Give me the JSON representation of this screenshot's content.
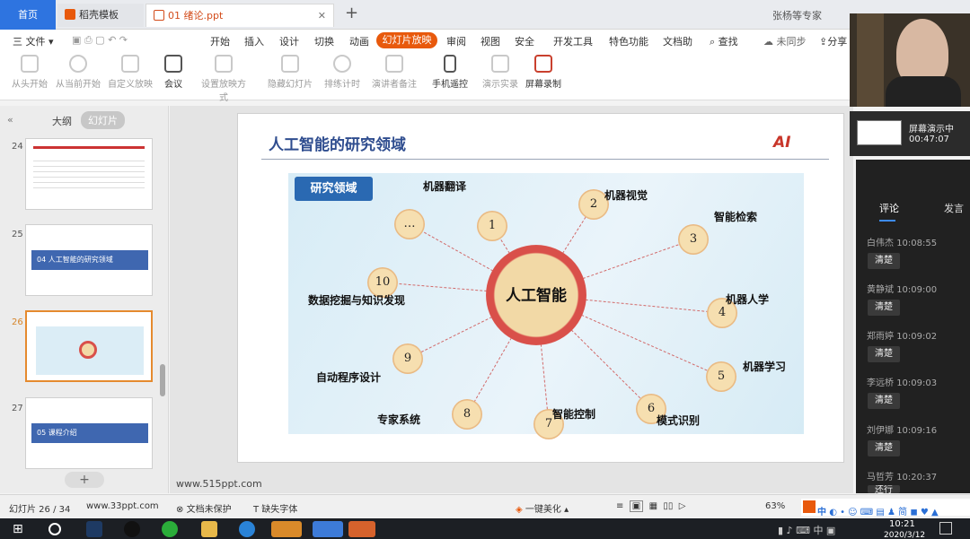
{
  "tabs": {
    "home": "首页",
    "template": "稻壳模板",
    "ppt": "01 绪论.ppt",
    "add": "+",
    "user": "张杨等专家"
  },
  "menu": {
    "file": "三 文件 ▾",
    "items": [
      "开始",
      "插入",
      "设计",
      "切换",
      "动画",
      "审阅",
      "视图",
      "安全",
      "开发工具",
      "特色功能",
      "文档助"
    ],
    "active": "幻灯片放映",
    "search": "查找",
    "sync": "未同步",
    "share": "分享"
  },
  "ribbon": {
    "buttons": [
      "从头开始",
      "从当前开始",
      "自定义放映",
      "会议",
      "设置放映方式",
      "隐藏幻灯片",
      "排练计时",
      "演讲者备注",
      "手机遥控",
      "演示实录",
      "屏幕录制"
    ]
  },
  "left_panel": {
    "tab_outline": "大纲",
    "tab_slides": "幻灯片",
    "slides": [
      {
        "num": "24"
      },
      {
        "num": "25",
        "title": "04 人工智能的研究领域"
      },
      {
        "num": "26"
      },
      {
        "num": "27",
        "title": "05 课程介绍"
      }
    ]
  },
  "slide": {
    "title": "人工智能的研究领域",
    "logo": "AI",
    "diagram_label": "研究领域",
    "hub": "人工智能",
    "nodes": [
      {
        "n": "…",
        "label": ""
      },
      {
        "n": "1",
        "label": "机器翻译"
      },
      {
        "n": "2",
        "label": "机器视觉"
      },
      {
        "n": "3",
        "label": "智能检索"
      },
      {
        "n": "4",
        "label": "机器人学"
      },
      {
        "n": "5",
        "label": "机器学习"
      },
      {
        "n": "6",
        "label": "模式识别"
      },
      {
        "n": "7",
        "label": "智能控制"
      },
      {
        "n": "8",
        "label": "专家系统"
      },
      {
        "n": "9",
        "label": "自动程序设计"
      },
      {
        "n": "10",
        "label": "数据挖掘与知识发现"
      }
    ]
  },
  "slide_footer": "www.515ppt.com",
  "meeting": {
    "status": "屏幕演示中",
    "timer": "00:47:07",
    "tab_comment": "评论",
    "tab_speak": "发言",
    "messages": [
      {
        "name": "白伟杰",
        "time": "10:08:55"
      },
      {
        "name": "黄静斌",
        "time": "10:09:00"
      },
      {
        "name": "郑雨婷",
        "time": "10:09:02"
      },
      {
        "name": "李远桥",
        "time": "10:09:03"
      },
      {
        "name": "刘伊娜",
        "time": "10:09:16"
      },
      {
        "name": "马哲芳",
        "time": "10:20:37"
      }
    ],
    "reply": "清楚",
    "reply_last": "还行"
  },
  "statusbar": {
    "slide_count": "幻灯片 26 / 34",
    "site": "www.33ppt.com",
    "protect": "文档未保护",
    "font": "缺失字体",
    "beautify": "一键美化 ▴",
    "zoom": "63%"
  },
  "taskbar": {
    "time": "10:21",
    "date": "2020/3/12",
    "ime": "中"
  }
}
